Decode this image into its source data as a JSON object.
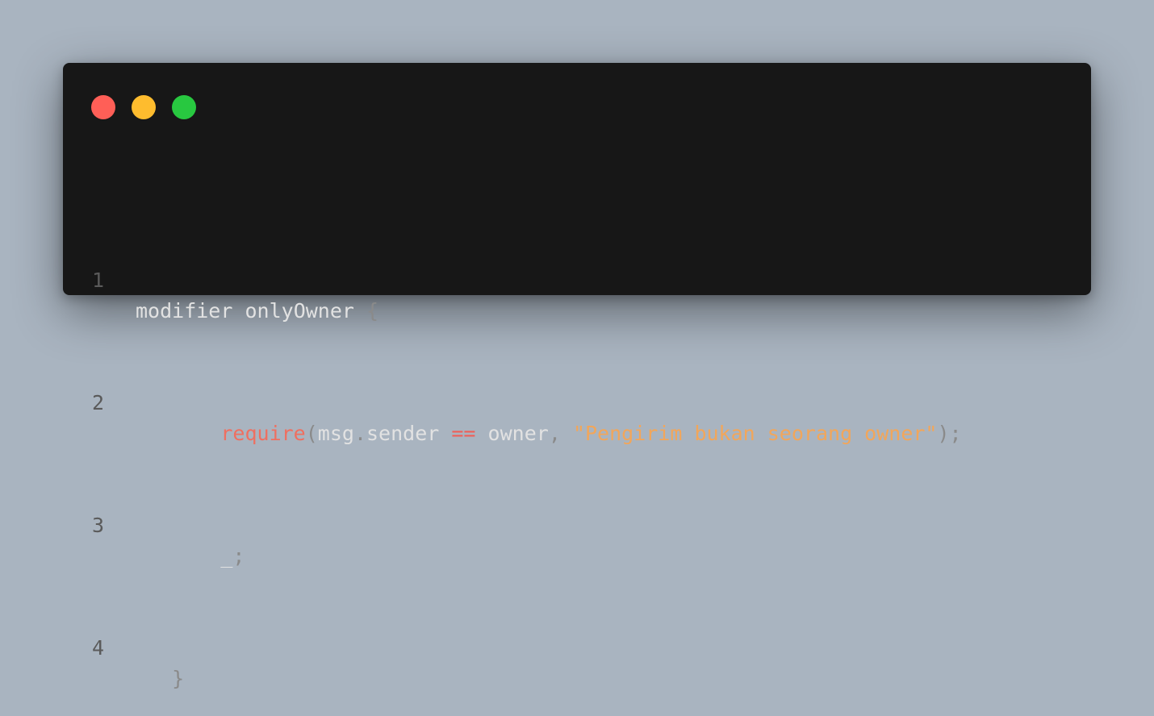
{
  "window": {
    "traffic_lights": [
      {
        "name": "close",
        "color": "#ff5f57"
      },
      {
        "name": "minimize",
        "color": "#febc2e"
      },
      {
        "name": "maximize",
        "color": "#28c840"
      }
    ]
  },
  "code": {
    "lines": [
      {
        "number": "1",
        "tokens": {
          "t1": "modifier",
          "t2": " ",
          "t3": "onlyOwner",
          "t4": " ",
          "t5": "{"
        }
      },
      {
        "number": "2",
        "indent": "       ",
        "tokens": {
          "t1": "require",
          "t2": "(",
          "t3": "msg",
          "t4": ".",
          "t5": "sender",
          "t6": " ",
          "t7": "==",
          "t8": " ",
          "t9": "owner",
          "t10": ",",
          "t11": " ",
          "t12": "\"Pengirim bukan seorang owner\"",
          "t13": ")",
          "t14": ";"
        }
      },
      {
        "number": "3",
        "indent": "       ",
        "tokens": {
          "t1": "_",
          "t2": ";"
        }
      },
      {
        "number": "4",
        "indent": "   ",
        "tokens": {
          "t1": "}"
        }
      }
    ]
  }
}
